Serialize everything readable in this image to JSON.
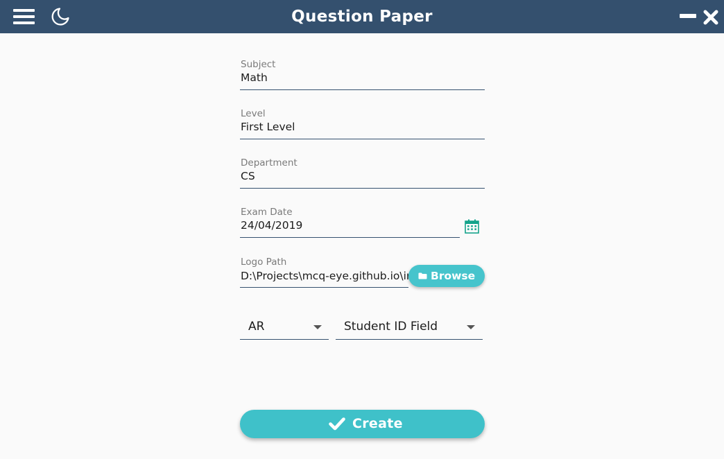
{
  "window": {
    "title": "Question Paper"
  },
  "form": {
    "subject": {
      "label": "Subject",
      "value": "Math"
    },
    "level": {
      "label": "Level",
      "value": "First Level"
    },
    "department": {
      "label": "Department",
      "value": "CS"
    },
    "exam_date": {
      "label": "Exam Date",
      "value": "24/04/2019"
    },
    "logo_path": {
      "label": "Logo Path",
      "value": "D:\\Projects\\mcq-eye.github.io\\im"
    },
    "browse_label": "Browse",
    "language_select": {
      "value": "AR"
    },
    "student_id_select": {
      "value": "Student ID Field"
    },
    "create_label": "Create"
  },
  "icons": {
    "menu": "hamburger-menu-icon",
    "theme": "moon-icon",
    "minimize": "minimize-icon",
    "close": "close-icon",
    "calendar": "calendar-icon",
    "folder": "folder-icon",
    "check": "check-icon",
    "caret": "caret-down-icon"
  },
  "colors": {
    "titlebar": "#34506e",
    "accent": "#3fc1c9",
    "calendar": "#14a38b",
    "background": "#fafafa"
  }
}
